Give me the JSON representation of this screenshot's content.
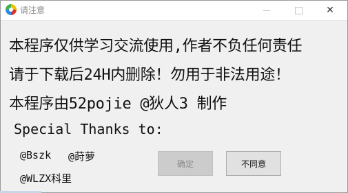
{
  "window": {
    "title": "请注意",
    "controls": {
      "minimize": "—",
      "maximize": "☐",
      "close": "✕"
    }
  },
  "message": {
    "line1": "本程序仅供学习交流使用,作者不负任何责任",
    "line2": "请于下载后24H内删除！勿用于非法用途！",
    "line3": "本程序由52pojie @狄人3 制作"
  },
  "thanks": {
    "heading": "Special Thanks to:",
    "names": [
      "@Bszk",
      "@莳萝",
      "@WLZX科里"
    ]
  },
  "buttons": {
    "ok_label": "确定",
    "disagree_label": "不同意"
  },
  "colors": {
    "window_bg": "#f0f0f0",
    "disabled_button": "#cccccc",
    "button": "#e1e1e1"
  }
}
